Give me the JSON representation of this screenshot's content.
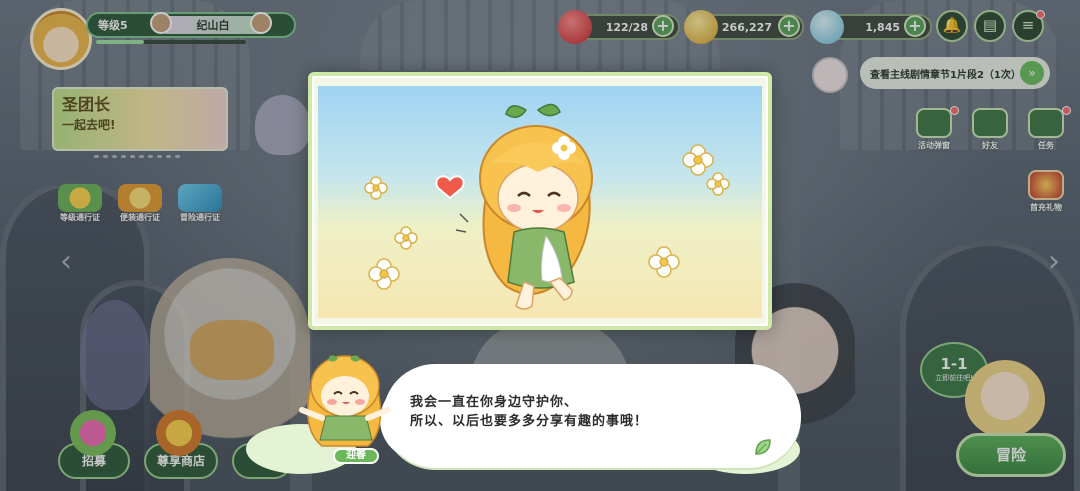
{
  "hud": {
    "level": "等级5",
    "player_name": "纪山白",
    "xp_progress": 0.32,
    "resources": [
      {
        "name": "stamina",
        "icon": "red-gem-icon",
        "value": "122/28",
        "color": "#d83b3b"
      },
      {
        "name": "gold",
        "icon": "gold-coin-icon",
        "value": "266,227",
        "color": "#f0c43a"
      },
      {
        "name": "diamond",
        "icon": "crystal-icon",
        "value": "1,845",
        "color": "#8fd3e8"
      }
    ],
    "plus_symbol": "+"
  },
  "quest_hint": {
    "text": "查看主线剧情章节1片段2（1次）",
    "arrow": "»"
  },
  "right_menu": [
    {
      "label": "活动弹窗",
      "icon": "calendar-icon"
    },
    {
      "label": "好友",
      "icon": "friends-icon"
    },
    {
      "label": "任务",
      "icon": "task-icon"
    },
    {
      "label": "首充礼物",
      "icon": "gift-icon"
    }
  ],
  "event_banner": {
    "text_line1": "圣团长",
    "text_line2": "一起去吧!"
  },
  "passes": [
    {
      "label": "等级通行证",
      "icon": "sunflower-icon"
    },
    {
      "label": "便装通行证",
      "icon": "clothes-icon"
    },
    {
      "label": "冒险通行证",
      "icon": "ticket-icon"
    }
  ],
  "bottom_bar": [
    {
      "label": "招募"
    },
    {
      "label": "尊享商店"
    }
  ],
  "stage": {
    "number": "1-1",
    "subtitle": "立即前往吧!"
  },
  "adventure_button": "冒险",
  "dialogue": {
    "speaker": "迎春",
    "line1": "我会一直在你身边守护你、",
    "line2": "所以、以后也要多多分享有趣的事哦！"
  },
  "colors": {
    "accent_green": "#5cb35a",
    "hud_dark": "#2f5a3a",
    "character_hair": "#f5b840"
  }
}
